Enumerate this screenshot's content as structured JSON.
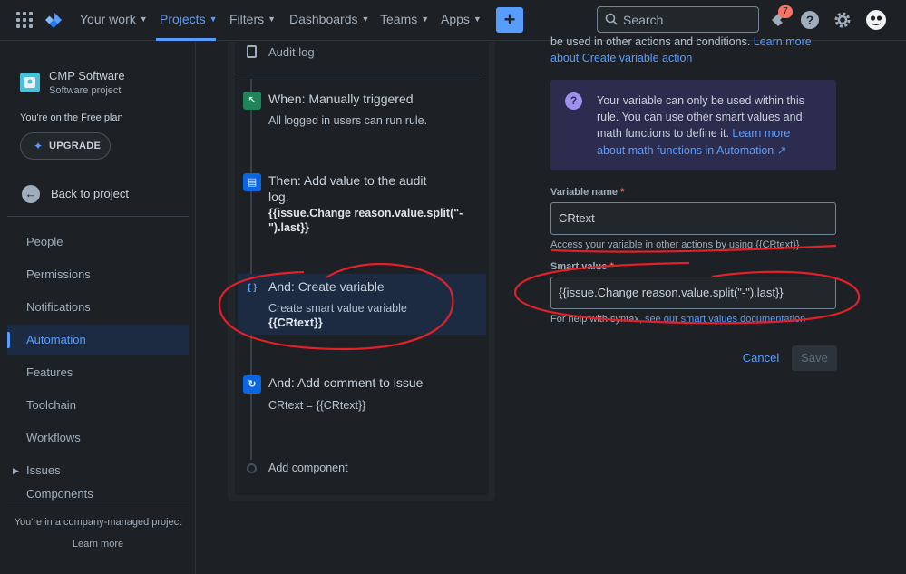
{
  "topnav": {
    "items": [
      {
        "label": "Your work"
      },
      {
        "label": "Projects"
      },
      {
        "label": "Filters"
      },
      {
        "label": "Dashboards"
      },
      {
        "label": "Teams"
      },
      {
        "label": "Apps"
      }
    ],
    "create_label": "+",
    "search_placeholder": "Search",
    "notifications_count": "7",
    "accent": "#579dff"
  },
  "sidebar": {
    "project_name": "CMP Software",
    "project_type": "Software project",
    "plan_note": "You're on the Free plan",
    "upgrade_label": "UPGRADE",
    "back_label": "Back to project",
    "items": [
      {
        "label": "People"
      },
      {
        "label": "Permissions"
      },
      {
        "label": "Notifications"
      },
      {
        "label": "Automation"
      },
      {
        "label": "Features"
      },
      {
        "label": "Toolchain"
      },
      {
        "label": "Workflows"
      },
      {
        "label": "Issues"
      },
      {
        "label": "Components"
      }
    ],
    "footer_note": "You're in a company-managed project",
    "footer_link": "Learn more"
  },
  "flow": {
    "audit_label": "Audit log",
    "steps": [
      {
        "title": "When: Manually triggered",
        "sub": "All logged in users can run rule."
      },
      {
        "title": "Then: Add value to the audit",
        "title2": "log.",
        "bold1": "{{issue.Change reason.value.split(\"-",
        "bold2": "\").last}}"
      },
      {
        "title": "And: Create variable",
        "sub": "Create smart value variable",
        "bold": "{{CRtext}}"
      },
      {
        "title": "And: Add comment to issue",
        "sub": "CRtext = {{CRtext}}"
      }
    ],
    "add_component": "Add component"
  },
  "config": {
    "intro_line1": "be used in other actions and conditions.",
    "intro_link1": "Learn more",
    "intro_link2": "about Create variable action",
    "info_lines": [
      "Your variable can only be used within this",
      "rule. You can use other smart values and",
      "math functions to define it."
    ],
    "info_link1": "Learn more",
    "info_link2": "about math functions in Automation ↗",
    "variable_name_label": "Variable name",
    "variable_name_value": "CRtext",
    "variable_helper": "Access your variable in other actions by using {{CRtext}}",
    "smart_value_label": "Smart value",
    "smart_value_value": "{{issue.Change reason.value.split(\"-\").last}}",
    "smart_helper": "For help with syntax,",
    "smart_helper_link": "see our smart values documentation",
    "required_mark": "*",
    "cancel_label": "Cancel",
    "save_label": "Save"
  },
  "annotation_color": "#e0202a"
}
